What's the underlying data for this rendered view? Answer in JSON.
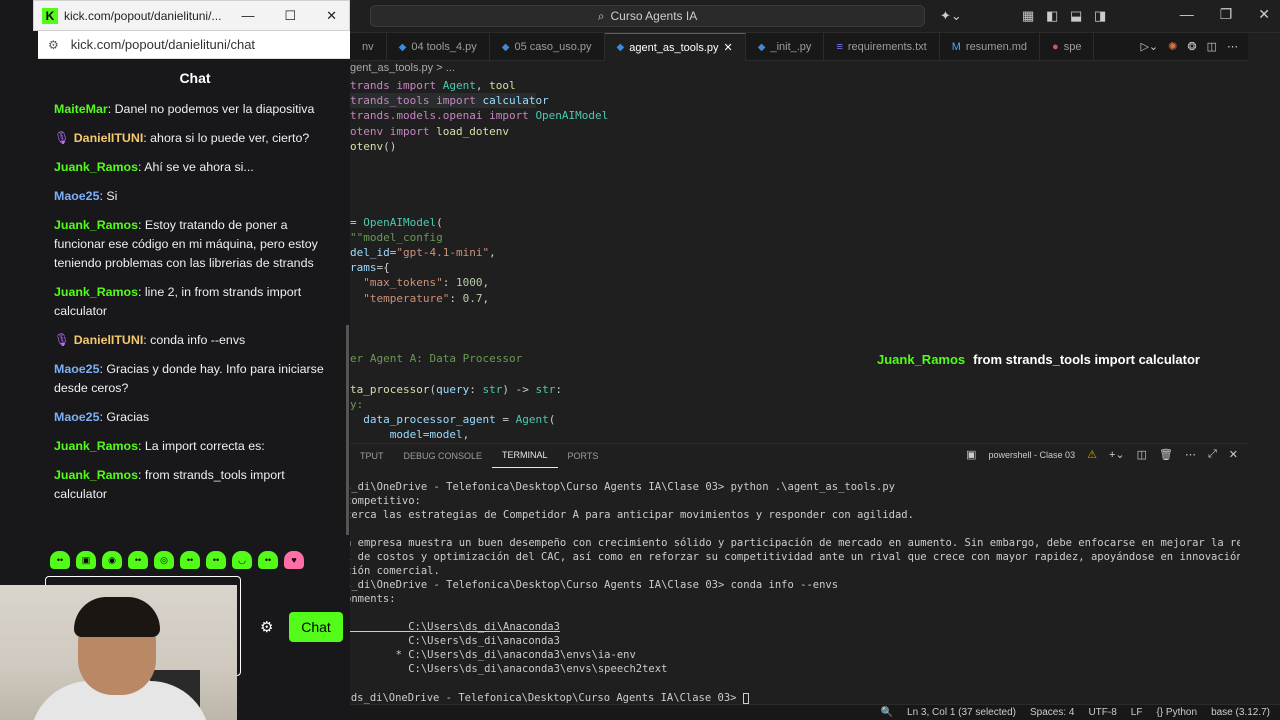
{
  "vscode": {
    "search_text": "Curso Agents IA",
    "tabs": [
      {
        "label": "nv",
        "active": false
      },
      {
        "label": "04 tools_4.py",
        "active": false
      },
      {
        "label": "05 caso_uso.py",
        "active": false
      },
      {
        "label": "agent_as_tools.py",
        "active": true
      },
      {
        "label": "_init_.py",
        "active": false
      },
      {
        "label": "requirements.txt",
        "active": false
      },
      {
        "label": "resumen.md",
        "active": false
      },
      {
        "label": "spe",
        "active": false
      }
    ],
    "breadcrumb": "gent_as_tools.py > ...",
    "overlay": {
      "user": "Juank_Ramos",
      "message": "from strands_tools import calculator"
    },
    "panel_tabs": [
      "TPUT",
      "DEBUG CONSOLE",
      "TERMINAL",
      "PORTS"
    ],
    "terminal_name": "powershell - Clase 03",
    "terminal_lines": [
      {
        "text": "s_di\\OneDrive - Telefonica\\Desktop\\Curso Agents IA\\Clase 03> python .\\agent_as_tools.py",
        "cls": ""
      },
      {
        "text": "competitivo:",
        "cls": ""
      },
      {
        "text": "cerca las estrategias de Competidor A para anticipar movimientos y responder con agilidad.",
        "cls": ""
      },
      {
        "text": "",
        "cls": ""
      },
      {
        "text": "a empresa muestra un buen desempeño con crecimiento sólido y participación de mercado en aumento. Sin embargo, debe enfocarse en mejorar la rentabilidad me",
        "cls": ""
      },
      {
        "text": "l de costos y optimización del CAC, así como en reforzar su competitividad ante un rival que crece con mayor rapidez, apoyándose en innovación, diferencia",
        "cls": ""
      },
      {
        "text": "ción comercial.",
        "cls": ""
      },
      {
        "text": "s_di\\OneDrive - Telefonica\\Desktop\\Curso Agents IA\\Clase 03> conda info --envs",
        "cls": ""
      },
      {
        "text": "onments:",
        "cls": ""
      },
      {
        "text": "",
        "cls": ""
      },
      {
        "text": "          C:\\Users\\ds_di\\Anaconda3",
        "cls": "t-ul"
      },
      {
        "text": "          C:\\Users\\ds_di\\anaconda3",
        "cls": ""
      },
      {
        "text": "        * C:\\Users\\ds_di\\anaconda3\\envs\\ia-env",
        "cls": ""
      },
      {
        "text": "          C:\\Users\\ds_di\\anaconda3\\envs\\speech2text",
        "cls": ""
      }
    ],
    "prompt": "PS C:\\Users\\ds_di\\OneDrive - Telefonica\\Desktop\\Curso Agents IA\\Clase 03> ",
    "status": {
      "position": "Ln 3, Col 1 (37 selected)",
      "spaces": "Spaces: 4",
      "encoding": "UTF-8",
      "eol": "LF",
      "language": "{} Python",
      "env": "base (3.12.7)"
    }
  },
  "browser": {
    "title": "kick.com/popout/danielituni/...",
    "url": "kick.com/popout/danielituni/chat"
  },
  "chat": {
    "header": "Chat",
    "messages": [
      {
        "user": "MaiteMar",
        "text": ": Danel no podemos ver la diapositiva",
        "color": "c-green",
        "mic": false
      },
      {
        "user": "DanielITUNI",
        "text": ": ahora si lo puede ver, cierto?",
        "color": "c-orange",
        "mic": true
      },
      {
        "user": "Juank_Ramos",
        "text": ": Ahí se ve ahora si...",
        "color": "c-green",
        "mic": false
      },
      {
        "user": "Maoe25",
        "text": ": Si",
        "color": "c-blue",
        "mic": false
      },
      {
        "user": "Juank_Ramos",
        "text": ": Estoy tratando de poner a funcionar ese código en mi máquina, pero estoy teniendo problemas con las librerias de strands",
        "color": "c-green",
        "mic": false
      },
      {
        "user": "Juank_Ramos",
        "text": ": line 2, in from strands import calculator",
        "color": "c-green",
        "mic": false
      },
      {
        "user": "DanielITUNI",
        "text": ": conda info --envs",
        "color": "c-orange",
        "mic": true
      },
      {
        "user": "Maoe25",
        "text": ": Gracias y donde hay. Info para iniciarse desde ceros?",
        "color": "c-blue",
        "mic": false
      },
      {
        "user": "Maoe25",
        "text": ": Gracias",
        "color": "c-blue",
        "mic": false
      },
      {
        "user": "Juank_Ramos",
        "text": ": La import correcta es:",
        "color": "c-green",
        "mic": false
      },
      {
        "user": "Juank_Ramos",
        "text": ": from strands_tools import calculator",
        "color": "c-green",
        "mic": false
      }
    ],
    "send_label": "Chat"
  },
  "colors": {
    "kick_green": "#53fc18",
    "vscode_bg": "#1f1f1f"
  }
}
